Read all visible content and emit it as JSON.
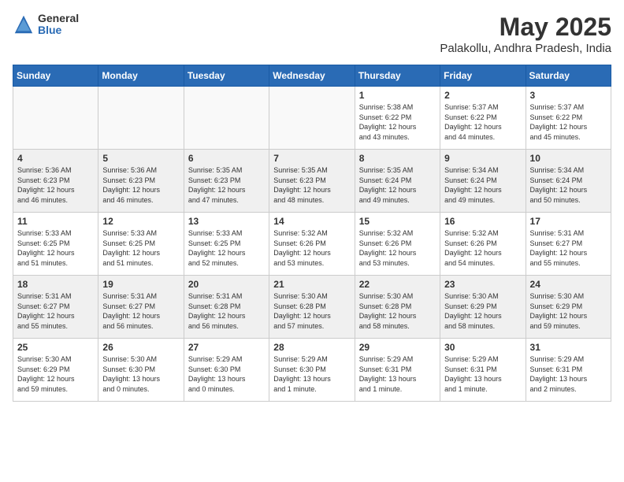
{
  "logo": {
    "general": "General",
    "blue": "Blue"
  },
  "header": {
    "month": "May 2025",
    "location": "Palakollu, Andhra Pradesh, India"
  },
  "weekdays": [
    "Sunday",
    "Monday",
    "Tuesday",
    "Wednesday",
    "Thursday",
    "Friday",
    "Saturday"
  ],
  "weeks": [
    [
      {
        "day": "",
        "info": ""
      },
      {
        "day": "",
        "info": ""
      },
      {
        "day": "",
        "info": ""
      },
      {
        "day": "",
        "info": ""
      },
      {
        "day": "1",
        "info": "Sunrise: 5:38 AM\nSunset: 6:22 PM\nDaylight: 12 hours\nand 43 minutes."
      },
      {
        "day": "2",
        "info": "Sunrise: 5:37 AM\nSunset: 6:22 PM\nDaylight: 12 hours\nand 44 minutes."
      },
      {
        "day": "3",
        "info": "Sunrise: 5:37 AM\nSunset: 6:22 PM\nDaylight: 12 hours\nand 45 minutes."
      }
    ],
    [
      {
        "day": "4",
        "info": "Sunrise: 5:36 AM\nSunset: 6:23 PM\nDaylight: 12 hours\nand 46 minutes."
      },
      {
        "day": "5",
        "info": "Sunrise: 5:36 AM\nSunset: 6:23 PM\nDaylight: 12 hours\nand 46 minutes."
      },
      {
        "day": "6",
        "info": "Sunrise: 5:35 AM\nSunset: 6:23 PM\nDaylight: 12 hours\nand 47 minutes."
      },
      {
        "day": "7",
        "info": "Sunrise: 5:35 AM\nSunset: 6:23 PM\nDaylight: 12 hours\nand 48 minutes."
      },
      {
        "day": "8",
        "info": "Sunrise: 5:35 AM\nSunset: 6:24 PM\nDaylight: 12 hours\nand 49 minutes."
      },
      {
        "day": "9",
        "info": "Sunrise: 5:34 AM\nSunset: 6:24 PM\nDaylight: 12 hours\nand 49 minutes."
      },
      {
        "day": "10",
        "info": "Sunrise: 5:34 AM\nSunset: 6:24 PM\nDaylight: 12 hours\nand 50 minutes."
      }
    ],
    [
      {
        "day": "11",
        "info": "Sunrise: 5:33 AM\nSunset: 6:25 PM\nDaylight: 12 hours\nand 51 minutes."
      },
      {
        "day": "12",
        "info": "Sunrise: 5:33 AM\nSunset: 6:25 PM\nDaylight: 12 hours\nand 51 minutes."
      },
      {
        "day": "13",
        "info": "Sunrise: 5:33 AM\nSunset: 6:25 PM\nDaylight: 12 hours\nand 52 minutes."
      },
      {
        "day": "14",
        "info": "Sunrise: 5:32 AM\nSunset: 6:26 PM\nDaylight: 12 hours\nand 53 minutes."
      },
      {
        "day": "15",
        "info": "Sunrise: 5:32 AM\nSunset: 6:26 PM\nDaylight: 12 hours\nand 53 minutes."
      },
      {
        "day": "16",
        "info": "Sunrise: 5:32 AM\nSunset: 6:26 PM\nDaylight: 12 hours\nand 54 minutes."
      },
      {
        "day": "17",
        "info": "Sunrise: 5:31 AM\nSunset: 6:27 PM\nDaylight: 12 hours\nand 55 minutes."
      }
    ],
    [
      {
        "day": "18",
        "info": "Sunrise: 5:31 AM\nSunset: 6:27 PM\nDaylight: 12 hours\nand 55 minutes."
      },
      {
        "day": "19",
        "info": "Sunrise: 5:31 AM\nSunset: 6:27 PM\nDaylight: 12 hours\nand 56 minutes."
      },
      {
        "day": "20",
        "info": "Sunrise: 5:31 AM\nSunset: 6:28 PM\nDaylight: 12 hours\nand 56 minutes."
      },
      {
        "day": "21",
        "info": "Sunrise: 5:30 AM\nSunset: 6:28 PM\nDaylight: 12 hours\nand 57 minutes."
      },
      {
        "day": "22",
        "info": "Sunrise: 5:30 AM\nSunset: 6:28 PM\nDaylight: 12 hours\nand 58 minutes."
      },
      {
        "day": "23",
        "info": "Sunrise: 5:30 AM\nSunset: 6:29 PM\nDaylight: 12 hours\nand 58 minutes."
      },
      {
        "day": "24",
        "info": "Sunrise: 5:30 AM\nSunset: 6:29 PM\nDaylight: 12 hours\nand 59 minutes."
      }
    ],
    [
      {
        "day": "25",
        "info": "Sunrise: 5:30 AM\nSunset: 6:29 PM\nDaylight: 12 hours\nand 59 minutes."
      },
      {
        "day": "26",
        "info": "Sunrise: 5:30 AM\nSunset: 6:30 PM\nDaylight: 13 hours\nand 0 minutes."
      },
      {
        "day": "27",
        "info": "Sunrise: 5:29 AM\nSunset: 6:30 PM\nDaylight: 13 hours\nand 0 minutes."
      },
      {
        "day": "28",
        "info": "Sunrise: 5:29 AM\nSunset: 6:30 PM\nDaylight: 13 hours\nand 1 minute."
      },
      {
        "day": "29",
        "info": "Sunrise: 5:29 AM\nSunset: 6:31 PM\nDaylight: 13 hours\nand 1 minute."
      },
      {
        "day": "30",
        "info": "Sunrise: 5:29 AM\nSunset: 6:31 PM\nDaylight: 13 hours\nand 1 minute."
      },
      {
        "day": "31",
        "info": "Sunrise: 5:29 AM\nSunset: 6:31 PM\nDaylight: 13 hours\nand 2 minutes."
      }
    ]
  ]
}
